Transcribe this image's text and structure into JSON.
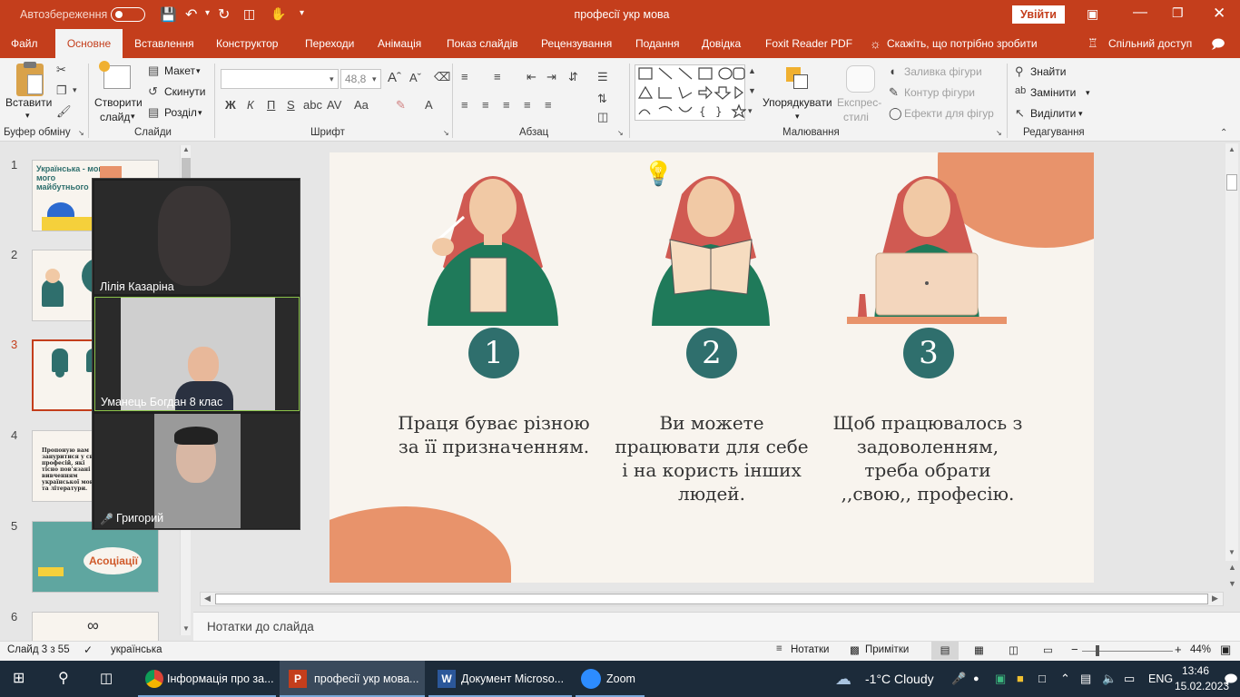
{
  "titlebar": {
    "autosave_label": "Автозбереження",
    "toggle_state": "Вимк",
    "document_title": "професії укр мова",
    "signin_label": "Увійти"
  },
  "tabs": [
    {
      "label": "Файл"
    },
    {
      "label": "Основне"
    },
    {
      "label": "Вставлення"
    },
    {
      "label": "Конструктор"
    },
    {
      "label": "Переходи"
    },
    {
      "label": "Анімація"
    },
    {
      "label": "Показ слайдів"
    },
    {
      "label": "Рецензування"
    },
    {
      "label": "Подання"
    },
    {
      "label": "Довідка"
    },
    {
      "label": "Foxit Reader PDF"
    },
    {
      "label": "Скажіть, що потрібно зробити"
    }
  ],
  "share_label": "Спільний доступ",
  "ribbon": {
    "paste_label": "Вставити",
    "clipboard_group": "Буфер обміну",
    "new_slide_label_1": "Створити",
    "new_slide_label_2": "слайд",
    "layout_label": "Макет",
    "reset_label": "Скинути",
    "section_label": "Розділ",
    "slides_group": "Слайди",
    "font_name_value": "",
    "font_size_value": "48,8",
    "font_group": "Шрифт",
    "bold": "Ж",
    "italic": "К",
    "underline": "П",
    "strike": "S",
    "paragraph_group": "Абзац",
    "arrange_label": "Упорядкувати",
    "quick_styles_label_1": "Експрес-",
    "quick_styles_label_2": "стилі",
    "shape_fill_label": "Заливка фігури",
    "shape_outline_label": "Контур фігури",
    "shape_effects_label": "Ефекти для фігур",
    "drawing_group": "Малювання",
    "find_label": "Знайти",
    "replace_label": "Замінити",
    "select_label": "Виділити",
    "editing_group": "Редагування"
  },
  "slides_panel": {
    "numbers": [
      "1",
      "2",
      "3",
      "4",
      "5",
      "6"
    ],
    "thumb1_title": "Українська - мова мого майбутнього",
    "thumb4_text": "Пропоную вам зануритися у світ професій, які тісно пов'язані з вивченням української мови та літератури.",
    "thumb5_title": "Асоціації"
  },
  "slide": {
    "numbers": [
      "1",
      "2",
      "3"
    ],
    "captions": [
      "Праця буває різною за її призначенням.",
      "Ви можете працювати для себе і на користь інших людей.",
      "Щоб працювалось з задоволенням, треба обрати ,,свою,, професію."
    ]
  },
  "zoom": {
    "participants": [
      {
        "name": "Лілія Казаріна"
      },
      {
        "name": "Уманець Богдан 8 клас"
      },
      {
        "name": "Григорий"
      }
    ]
  },
  "notes_placeholder": "Нотатки до слайда",
  "statusbar": {
    "slide_info": "Слайд 3 з 55",
    "language": "українська",
    "notes_label": "Нотатки",
    "comments_label": "Примітки",
    "zoom_level": "44%"
  },
  "taskbar": {
    "apps": [
      {
        "label": "Інформація про за..."
      },
      {
        "label": "професії укр мова..."
      },
      {
        "label": "Документ Microso..."
      },
      {
        "label": "Zoom"
      }
    ],
    "weather": "-1°C  Cloudy",
    "lang": "ENG",
    "time": "13:46",
    "date": "15.02.2023"
  },
  "colors": {
    "accent": "#c43e1c",
    "teal": "#2f6f6d",
    "salmon": "#e8936b",
    "slide_bg": "#f8f4ee"
  }
}
